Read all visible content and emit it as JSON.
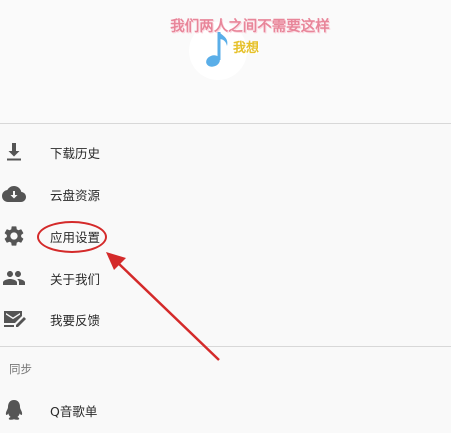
{
  "header": {
    "lyric": "我们两人之间不需要这样",
    "tag": "我想"
  },
  "menu": {
    "items": [
      {
        "id": "download-history",
        "label": "下载历史",
        "icon": "download-icon"
      },
      {
        "id": "cloud-resource",
        "label": "云盘资源",
        "icon": "cloud-download-icon"
      },
      {
        "id": "app-settings",
        "label": "应用设置",
        "icon": "gear-icon"
      },
      {
        "id": "about-us",
        "label": "关于我们",
        "icon": "people-icon"
      },
      {
        "id": "feedback",
        "label": "我要反馈",
        "icon": "feedback-icon"
      }
    ]
  },
  "sync": {
    "title": "同步",
    "items": [
      {
        "id": "qq-playlist",
        "label": "Q音歌单",
        "icon": "qq-icon"
      }
    ]
  },
  "colors": {
    "icon": "#555555",
    "annotation": "#d42a2a",
    "lyric": "#e8869a",
    "note": "#5aaee8"
  }
}
